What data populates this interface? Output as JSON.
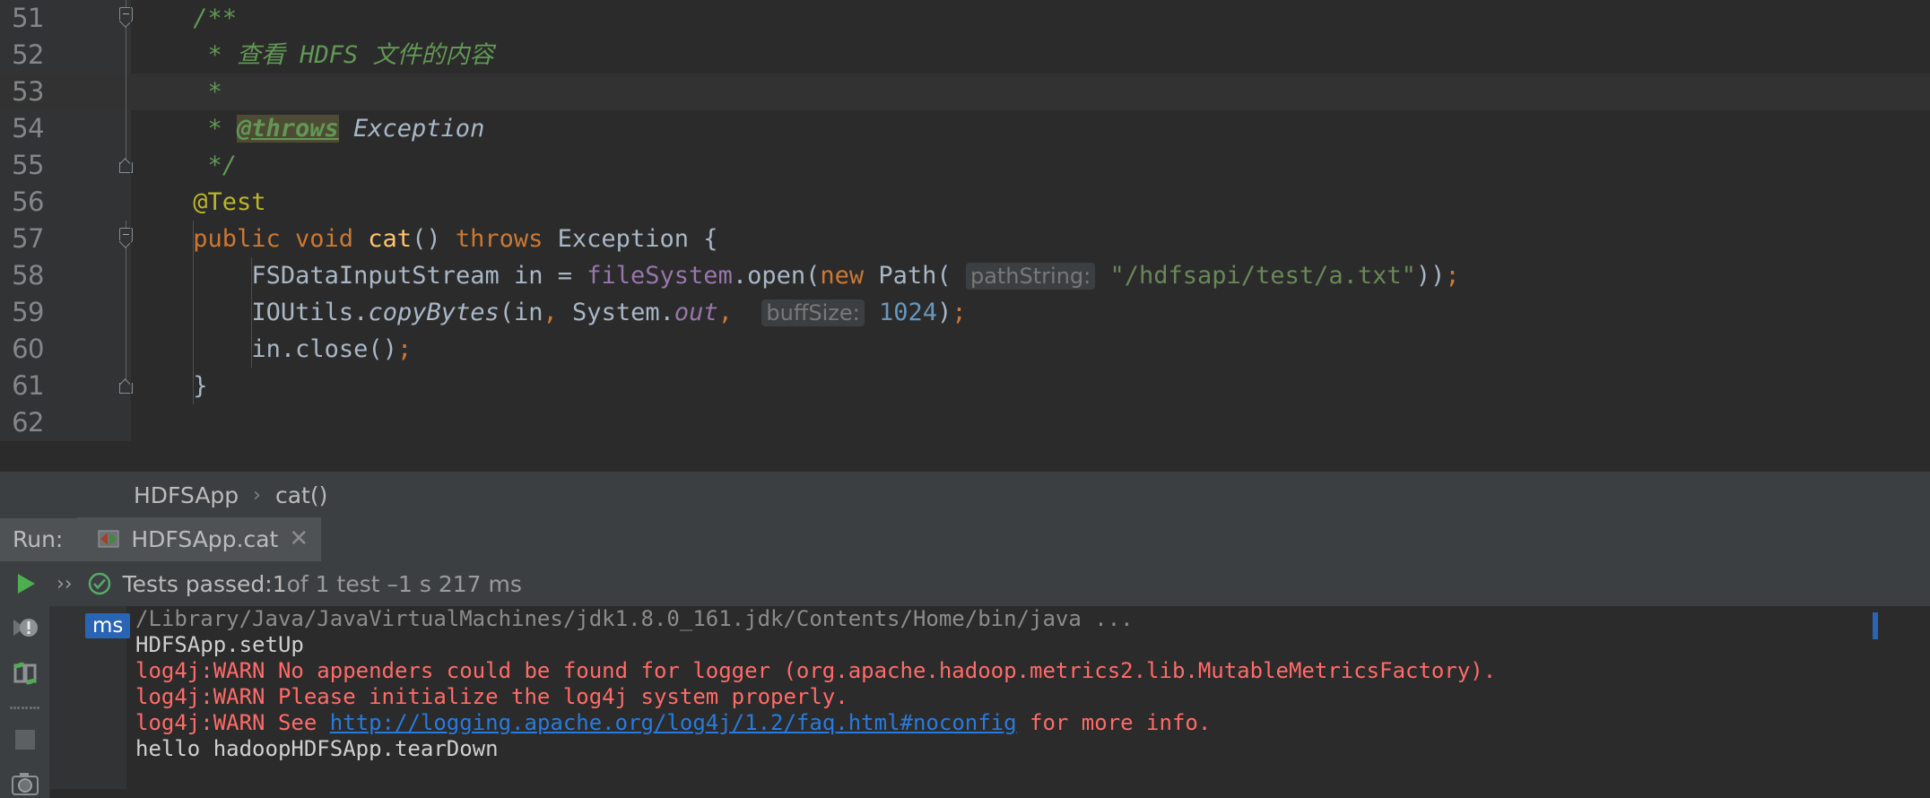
{
  "editor": {
    "first_line": 51,
    "lines": [
      {
        "num": 51,
        "highlight": false,
        "fold": "start",
        "run_icon": false
      },
      {
        "num": 52,
        "highlight": false,
        "fold": "mid",
        "run_icon": false
      },
      {
        "num": 53,
        "highlight": true,
        "fold": "mid",
        "run_icon": false
      },
      {
        "num": 54,
        "highlight": false,
        "fold": "mid",
        "run_icon": false
      },
      {
        "num": 55,
        "highlight": false,
        "fold": "end",
        "run_icon": false
      },
      {
        "num": 56,
        "highlight": false,
        "fold": "none",
        "run_icon": false
      },
      {
        "num": 57,
        "highlight": false,
        "fold": "start",
        "run_icon": true
      },
      {
        "num": 58,
        "highlight": false,
        "fold": "mid",
        "run_icon": false
      },
      {
        "num": 59,
        "highlight": false,
        "fold": "mid",
        "run_icon": false
      },
      {
        "num": 60,
        "highlight": false,
        "fold": "mid",
        "run_icon": false
      },
      {
        "num": 61,
        "highlight": false,
        "fold": "end",
        "run_icon": false
      },
      {
        "num": 62,
        "highlight": false,
        "fold": "none",
        "run_icon": false
      }
    ],
    "code": {
      "l51": "/**",
      "l52_star": " * ",
      "l52_text": "查看 HDFS 文件的内容",
      "l53": " *",
      "l54_star": " * ",
      "l54_tag": "@throws",
      "l54_rest": " Exception",
      "l55": " */",
      "l56": "@Test",
      "l57_kw1": "public",
      "l57_kw2": "void",
      "l57_name": "cat",
      "l57_parens": "() ",
      "l57_kw3": "throws",
      "l57_type": " Exception {",
      "l58_type": "FSDataInputStream in = ",
      "l58_field": "fileSystem",
      "l58_dot_open": ".open(",
      "l58_new": "new",
      "l58_path": " Path( ",
      "l58_hint": "pathString:",
      "l58_str": "\"/hdfsapi/test/a.txt\"",
      "l58_close": "))",
      "l58_semi": ";",
      "l59_cls": "IOUtils.",
      "l59_mth": "copyBytes",
      "l59_arg1": "(in",
      "l59_comma1": ",",
      "l59_sys": " System.",
      "l59_out": "out",
      "l59_comma2": ",",
      "l59_hint": "buffSize:",
      "l59_num": "1024",
      "l59_paren": ")",
      "l59_semi": ";",
      "l60_call": "in.close()",
      "l60_semi": ";",
      "l61": "}"
    }
  },
  "breadcrumb": {
    "items": [
      "HDFSApp",
      "cat()"
    ],
    "separator": "›"
  },
  "run_window": {
    "label": "Run:",
    "tab_name": "HDFSApp.cat",
    "tab_close": "✕",
    "expand_chevron": "››",
    "status": {
      "text_prefix": "Tests passed: ",
      "count": "1",
      "text_mid": " of 1 test – ",
      "duration": "1 s 217 ms"
    },
    "toolbar_icons": [
      "rerun-icon",
      "rerun-failed-icon",
      "toggle-auto-test-icon",
      "dots-separator",
      "stop-icon",
      "screenshot-icon"
    ],
    "gutter_badge": "ms",
    "console": [
      {
        "type": "dim",
        "text": "/Library/Java/JavaVirtualMachines/jdk1.8.0_161.jdk/Contents/Home/bin/java ..."
      },
      {
        "type": "white",
        "text": "HDFSApp.setUp"
      },
      {
        "type": "red",
        "text": "log4j:WARN No appenders could be found for logger (org.apache.hadoop.metrics2.lib.MutableMetricsFactory)."
      },
      {
        "type": "red",
        "text": "log4j:WARN Please initialize the log4j system properly."
      },
      {
        "type": "red-link",
        "pre": "log4j:WARN See ",
        "link": "http://logging.apache.org/log4j/1.2/faq.html#noconfig",
        "post": " for more info."
      },
      {
        "type": "white",
        "text": "hello hadoopHDFSApp.tearDown"
      }
    ]
  },
  "colors": {
    "editor_bg": "#2b2b2b",
    "gutter_bg": "#313335",
    "panel_bg": "#3c3f41",
    "comment_green": "#629755",
    "annotation_yellow": "#bbb529",
    "keyword_orange": "#cc7832",
    "method_yellow": "#ffc66d",
    "field_purple": "#9876aa",
    "string_green": "#6a8759",
    "number_blue": "#6897bb",
    "text_default": "#a9b7c6",
    "error_red": "#ff6b68",
    "link_blue": "#287bde",
    "badge_blue": "#2a64b4",
    "pass_green": "#59a869"
  }
}
